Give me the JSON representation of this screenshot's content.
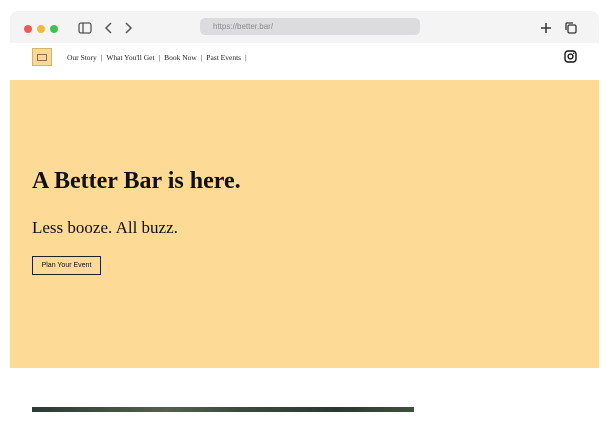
{
  "browser": {
    "url": "https://better.bar/",
    "icons": [
      "sidebar-icon",
      "back-icon",
      "forward-icon",
      "new-tab-icon",
      "tabs-icon"
    ]
  },
  "header": {
    "nav": [
      {
        "label": "Our Story"
      },
      {
        "label": "What You'll Get"
      },
      {
        "label": "Book Now"
      },
      {
        "label": "Past Events"
      }
    ],
    "separator": "|",
    "social_icon": "instagram-icon"
  },
  "hero": {
    "title": "A Better Bar is here.",
    "subtitle": "Less booze. All buzz.",
    "cta_label": "Plan Your Event"
  },
  "colors": {
    "hero_bg": "#fddb97",
    "logo_bg": "#fcd993",
    "browser_bg": "#f4f4f5"
  }
}
